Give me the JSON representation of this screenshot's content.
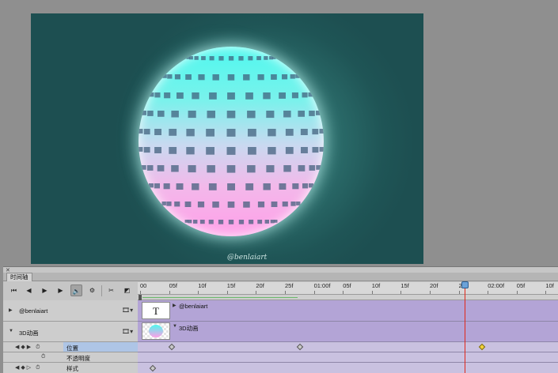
{
  "canvas": {
    "signature": "@benlaiart",
    "background": "#1f5556",
    "sphere_top_color": "#4ff8ee",
    "sphere_bottom_color": "#ff9fe8"
  },
  "panel": {
    "close_icon": "close-icon",
    "tab_label": "时间轴"
  },
  "controls": {
    "buttons": [
      "go-to-first-frame",
      "previous-frame",
      "play",
      "next-frame",
      "audio",
      "settings",
      "split",
      "transition"
    ],
    "audio_pressed": true
  },
  "ruler": {
    "ticks": [
      "00",
      "05f",
      "10f",
      "15f",
      "20f",
      "25f",
      "01:00f",
      "05f",
      "10f",
      "15f",
      "20f",
      "25f",
      "02:00f",
      "05f",
      "10f"
    ]
  },
  "layers": [
    {
      "name": "@benlaiart",
      "bar_label": "@benlaiart",
      "thumb_text": "T",
      "expanded": false
    },
    {
      "name": "3D动画",
      "bar_label": "3D动画",
      "expanded": true,
      "properties": [
        {
          "name": "位置",
          "highlighted": true
        },
        {
          "name": "不透明度",
          "highlighted": false
        },
        {
          "name": "样式",
          "highlighted": false
        }
      ]
    }
  ],
  "colors": {
    "layer_bar": "#b3a4d6",
    "property_track": "#c9c1e0",
    "playhead": "#e0281b",
    "selected_keyframe": "#f3d33a"
  }
}
